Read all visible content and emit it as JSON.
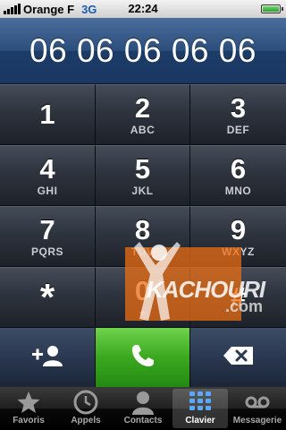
{
  "status_bar": {
    "carrier": "Orange F",
    "network": "3G",
    "time": "22:24",
    "signal_bars": 5,
    "battery_level": 1.0
  },
  "display": {
    "number": "06 06 06 06 06"
  },
  "keypad": {
    "keys": [
      {
        "digit": "1",
        "letters": ""
      },
      {
        "digit": "2",
        "letters": "ABC"
      },
      {
        "digit": "3",
        "letters": "DEF"
      },
      {
        "digit": "4",
        "letters": "GHI"
      },
      {
        "digit": "5",
        "letters": "JKL"
      },
      {
        "digit": "6",
        "letters": "MNO"
      },
      {
        "digit": "7",
        "letters": "PQRS"
      },
      {
        "digit": "8",
        "letters": "TUV"
      },
      {
        "digit": "9",
        "letters": "WXYZ"
      },
      {
        "digit": "*",
        "letters": ""
      },
      {
        "digit": "0",
        "letters": "+"
      },
      {
        "digit": "#",
        "letters": ""
      }
    ]
  },
  "actions": {
    "add_contact_icon": "add-contact-icon",
    "call_icon": "phone-icon",
    "delete_icon": "backspace-icon"
  },
  "tabbar": {
    "tabs": [
      {
        "label": "Favoris",
        "icon": "star-icon",
        "active": false
      },
      {
        "label": "Appels",
        "icon": "clock-icon",
        "active": false
      },
      {
        "label": "Contacts",
        "icon": "contact-icon",
        "active": false
      },
      {
        "label": "Clavier",
        "icon": "keypad-icon",
        "active": true
      },
      {
        "label": "Messagerie",
        "icon": "voicemail-icon",
        "active": false
      }
    ]
  },
  "watermark": {
    "line1": "KACHOURI",
    "line2": ".com"
  },
  "colors": {
    "display_blue": "#2c4e7c",
    "call_green": "#3aa81f",
    "watermark_orange": "#eb6e14"
  }
}
